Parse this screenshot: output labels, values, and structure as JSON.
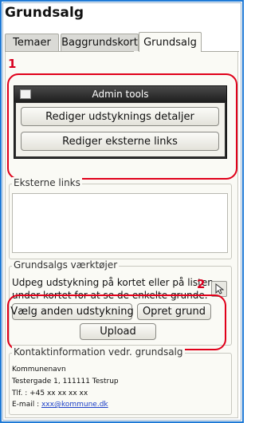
{
  "window": {
    "title": "Grundsalg"
  },
  "tabs": [
    {
      "label": "Temaer",
      "active": false
    },
    {
      "label": "Baggrundskort",
      "active": false
    },
    {
      "label": "Grundsalg",
      "active": true
    }
  ],
  "annotations": {
    "marker_1": "1",
    "marker_2": "2",
    "marker_color": "#e0001a"
  },
  "admin_tools": {
    "title": "Admin tools",
    "buttons": [
      "Rediger udstyknings detaljer",
      "Rediger eksterne links"
    ]
  },
  "external_links": {
    "legend": "Eksterne links",
    "content": ""
  },
  "tools": {
    "legend": "Grundsalgs værktøjer",
    "description_line1": "Udpeg udstykning på kortet eller på listen",
    "description_line2": "under kortet for at se de enkelte grunde.",
    "select_tool_icon": "pointer-arrow-icon",
    "buttons": {
      "choose": "Vælg anden udstykning",
      "create": "Opret grund",
      "upload": "Upload"
    }
  },
  "contact": {
    "legend": "Kontaktinformation vedr. grundsalg",
    "name": "Kommunenavn",
    "address": "Testergade 1, 111111 Testrup",
    "phone": "Tlf. : +45 xx xx xx xx",
    "email_label": "E-mail : ",
    "email": "xxx@kommune.dk"
  }
}
